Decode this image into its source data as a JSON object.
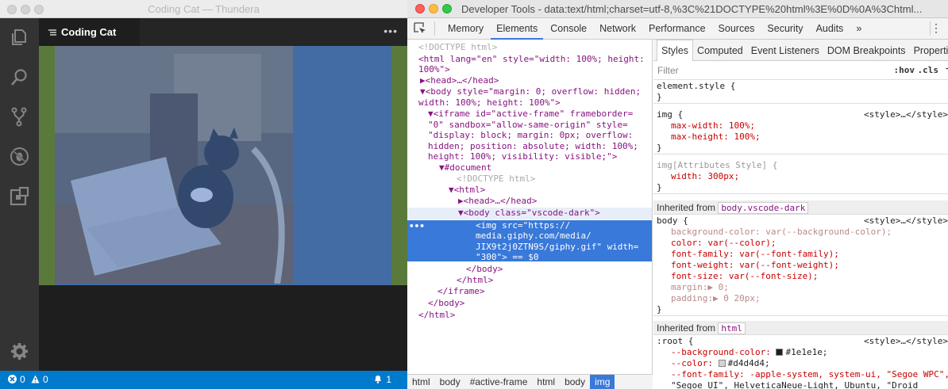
{
  "editor": {
    "window_title": "Coding Cat — Thundera",
    "tab_label": "Coding Cat",
    "more": "•••",
    "status": {
      "errors": "0",
      "warnings": "0",
      "notifications": "1"
    }
  },
  "devtools": {
    "window_title": "Developer Tools - data:text/html;charset=utf-8,%3C%21DOCTYPE%20html%3E%0D%0A%3Chtml...",
    "tabs": [
      "Memory",
      "Elements",
      "Console",
      "Network",
      "Performance",
      "Sources",
      "Security",
      "Audits",
      "»"
    ],
    "active_tab": "Elements",
    "dom_lines": [
      [
        "cm",
        "<!DOCTYPE html>"
      ],
      [
        "tag",
        "<html lang=\"en\" style=\"width: 100%; height:"
      ],
      [
        "tag",
        "100%\">"
      ],
      [
        "tag",
        "▶<head>…</head>"
      ],
      [
        "tag",
        "▼<body style=\"margin: 0; overflow: hidden;"
      ],
      [
        "tag",
        "width: 100%; height: 100%\">"
      ],
      [
        "tag",
        "▼<iframe id=\"active-frame\" frameborder="
      ],
      [
        "tag",
        "\"0\" sandbox=\"allow-same-origin\" style="
      ],
      [
        "tag",
        "\"display: block; margin: 0px; overflow:"
      ],
      [
        "tag",
        "hidden; position: absolute; width: 100%;"
      ],
      [
        "tag",
        "height: 100%; visibility: visible;\">"
      ],
      [
        "tag",
        "▼#document"
      ],
      [
        "cm",
        "<!DOCTYPE html>"
      ],
      [
        "tag",
        "▼<html>"
      ],
      [
        "tag",
        "▶<head>…</head>"
      ],
      [
        "tag",
        "▼<body class=\"vscode-dark\">"
      ],
      [
        "sel",
        "<img src=\"https://"
      ],
      [
        "sel",
        "media.giphy.com/media/"
      ],
      [
        "sel",
        "JIX9t2j0ZTN9S/giphy.gif\" width="
      ],
      [
        "sel",
        "\"300\"> == $0"
      ],
      [
        "tag",
        "</body>"
      ],
      [
        "tag",
        "</html>"
      ],
      [
        "tag",
        "</iframe>"
      ],
      [
        "tag",
        "</body>"
      ],
      [
        "tag",
        "</html>"
      ]
    ],
    "breadcrumbs": [
      "html",
      "body",
      "#active-frame",
      "html",
      "body",
      "img"
    ],
    "styles": {
      "tabs": [
        "Styles",
        "Computed",
        "Event Listeners",
        "DOM Breakpoints",
        "Properties"
      ],
      "filter_placeholder": "Filter",
      "hov": ":hov",
      "cls": ".cls",
      "plus": "+",
      "element_style": "element.style {",
      "close": "}",
      "img_sel": "img {",
      "img_src": "<style>…</style>",
      "img_decl1": "max-width: 100%;",
      "img_decl2": "max-height: 100%;",
      "attr_sel": "img[Attributes Style] {",
      "attr_decl": "width: 300px;",
      "inh1_label": "Inherited from",
      "inh1_pill": "body.vscode-dark",
      "body_sel": "body {",
      "body_src": "<style>…</style>",
      "body_decls": [
        "background-color: var(--background-color);",
        "color: var(--color);",
        "font-family: var(--font-family);",
        "font-weight: var(--font-weight);",
        "font-size: var(--font-size);",
        "margin:▶ 0;",
        "padding:▶ 0 20px;"
      ],
      "inh2_label": "Inherited from",
      "inh2_pill": "html",
      "root_sel": ":root {",
      "root_src": "<style>…</style>",
      "root_decl1": "--background-color: ",
      "root_val1": "#1e1e1e;",
      "root_decl2": "--color: ",
      "root_val2": "#d4d4d4;",
      "root_decl3": "--font-family: -apple-system, system-ui, \"Segoe WPC\",",
      "root_decl4": "\"Segoe UI\", HelveticaNeue-Light, Ubuntu, \"Droid"
    }
  },
  "colors": {
    "swatch1": "#1e1e1e",
    "swatch2": "#d4d4d4",
    "accent": "#3879d9",
    "status": "#007acc"
  }
}
